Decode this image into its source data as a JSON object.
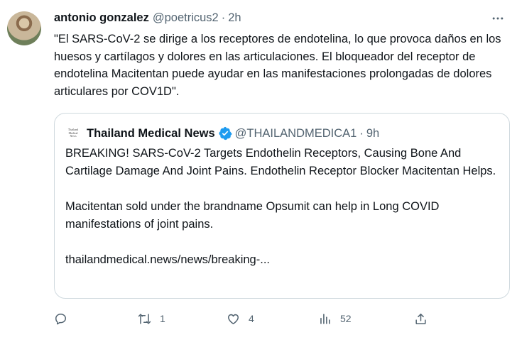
{
  "tweet": {
    "display_name": "antonio gonzalez",
    "handle": "@poetricus2",
    "separator": "·",
    "time": "2h",
    "text": "\"El SARS-CoV-2 se dirige a los receptores de endotelina, lo que provoca daños en los huesos y cartílagos y dolores en las articulaciones. El bloqueador del receptor de endotelina Macitentan puede ayudar en las manifestaciones prolongadas de dolores articulares por COV1D\"."
  },
  "quote": {
    "avatar_text": [
      "Thailand",
      "Medical",
      "News"
    ],
    "display_name": "Thailand Medical News",
    "handle": "@THAILANDMEDICA1",
    "separator": "·",
    "time": "9h",
    "paragraph1": "BREAKING! SARS-CoV-2 Targets Endothelin Receptors, Causing Bone And Cartilage Damage And Joint Pains. Endothelin Receptor Blocker Macitentan Helps.",
    "paragraph2": "Macitentan sold under the brandname Opsumit can help in Long COVID manifestations of joint pains.",
    "link": "thailandmedical.news/news/breaking-..."
  },
  "actions": {
    "reply_count": "",
    "retweet_count": "1",
    "like_count": "4",
    "views_count": "52"
  },
  "icons": {
    "more": "more-icon",
    "verified": "verified-badge-icon",
    "reply": "reply-icon",
    "retweet": "retweet-icon",
    "like": "like-icon",
    "views": "views-icon",
    "share": "share-icon"
  },
  "colors": {
    "text": "#0f1419",
    "secondary": "#536471",
    "verified": "#1d9bf0",
    "border": "#cfd9de"
  }
}
